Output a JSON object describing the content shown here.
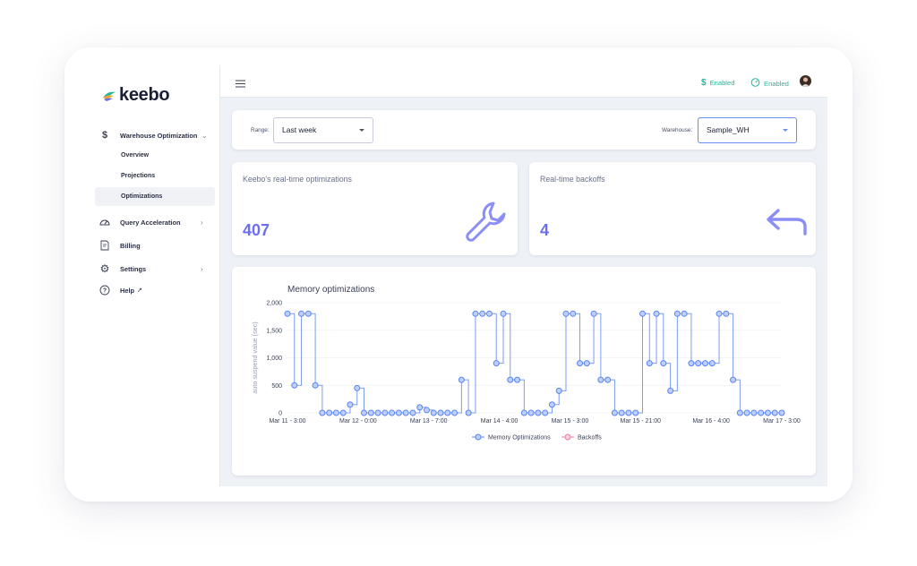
{
  "app": {
    "logo_text": "keebo"
  },
  "sidebar": {
    "section": {
      "label": "Warehouse Optimization"
    },
    "sub_items": [
      {
        "label": "Overview"
      },
      {
        "label": "Projections"
      },
      {
        "label": "Optimizations"
      }
    ],
    "items": [
      {
        "label": "Query Acceleration"
      },
      {
        "label": "Billing"
      },
      {
        "label": "Settings"
      },
      {
        "label": "Help"
      }
    ]
  },
  "topbar": {
    "status1": "Enabled",
    "status2": "Enabled"
  },
  "filters": {
    "range_label": "Range:",
    "range_value": "Last week",
    "warehouse_label": "Warehouse:",
    "warehouse_value": "Sample_WH"
  },
  "kpis": {
    "optimizations": {
      "title": "Keebo's real-time optimizations",
      "value": "407"
    },
    "backoffs": {
      "title": "Real-time backoffs",
      "value": "4"
    }
  },
  "colors": {
    "accent": "#6b6ef0",
    "series1": "#7b9cf0",
    "series2": "#f3a0bd",
    "enabled": "#1fb89a"
  },
  "chart_data": {
    "type": "line",
    "title": "Memory optimizations",
    "ylabel": "auto suspend value (sec)",
    "ylim": [
      0,
      2000
    ],
    "yticks": [
      "0",
      "500",
      "1,000",
      "1,500",
      "2,000"
    ],
    "x_ticks": [
      "Mar 11 - 3:00",
      "Mar 12 - 0:00",
      "Mar 13 - 7:00",
      "Mar 14 - 4:00",
      "Mar 15 - 3:00",
      "Mar 15 - 21:00",
      "Mar 16 - 4:00",
      "Mar 17 - 3:00"
    ],
    "step": true,
    "series": [
      {
        "name": "Memory Optimizations",
        "values": [
          1800,
          500,
          1800,
          1800,
          500,
          0,
          0,
          0,
          0,
          150,
          450,
          0,
          0,
          0,
          0,
          0,
          0,
          0,
          0,
          100,
          50,
          0,
          0,
          0,
          0,
          600,
          0,
          1800,
          1800,
          1800,
          900,
          1800,
          600,
          600,
          0,
          0,
          0,
          0,
          150,
          400,
          1800,
          1800,
          900,
          900,
          1800,
          600,
          600,
          0,
          0,
          0,
          0,
          1800,
          900,
          1800,
          900,
          400,
          1800,
          1800,
          900,
          900,
          900,
          900,
          1800,
          1800,
          600,
          0,
          0,
          0,
          0,
          0,
          0,
          0
        ]
      },
      {
        "name": "Backoffs",
        "values": []
      }
    ],
    "legend": "bottom"
  }
}
